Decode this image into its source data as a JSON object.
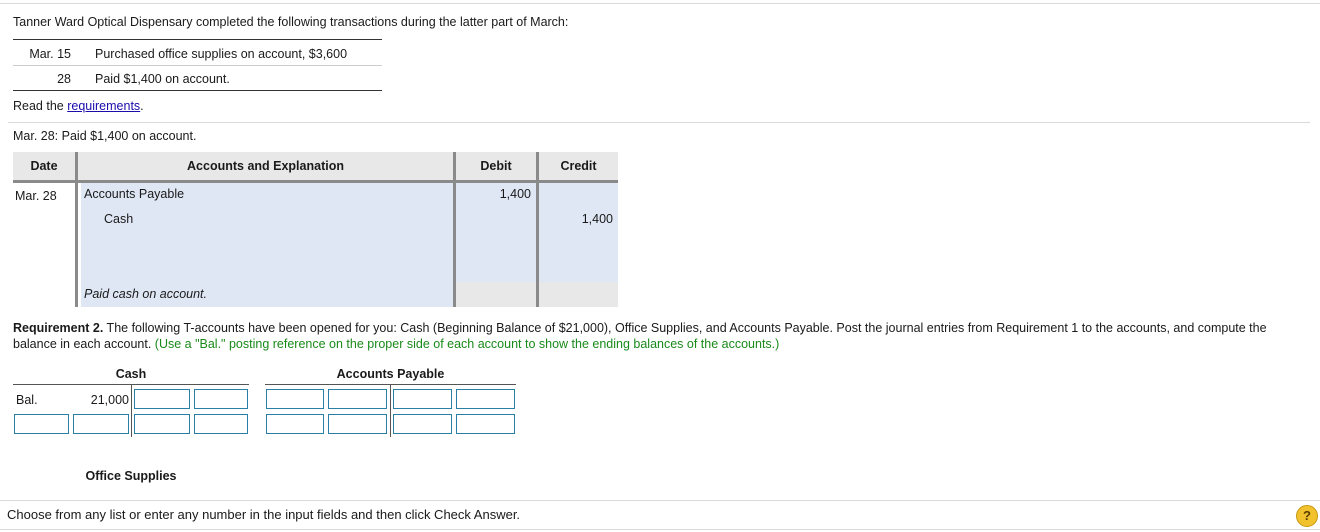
{
  "intro": "Tanner Ward Optical Dispensary completed the following transactions during the latter part of March:",
  "transactions": [
    {
      "date": "Mar. 15",
      "desc": "Purchased office supplies on account, $3,600"
    },
    {
      "date": "28",
      "desc": "Paid $1,400 on account."
    }
  ],
  "read_prefix": "Read the ",
  "read_link": "requirements",
  "read_suffix": ".",
  "task_line": "Mar. 28: Paid $1,400 on account.",
  "journal": {
    "headers": {
      "date": "Date",
      "accounts": "Accounts and Explanation",
      "debit": "Debit",
      "credit": "Credit"
    },
    "date": "Mar. 28",
    "debit_account": "Accounts Payable",
    "credit_account": "Cash",
    "debit_amount": "1,400",
    "credit_amount": "1,400",
    "explanation": "Paid cash on account."
  },
  "requirement": {
    "label": "Requirement 2.",
    "text": " The following T-accounts have been opened for you: Cash (Beginning Balance of $21,000), Office Supplies, and Accounts Payable. Post the journal entries from Requirement 1 to the accounts, and compute the balance in each account. ",
    "hint": "(Use a \"Bal.\" posting reference on the proper side of each account to show the ending balances of the accounts.)"
  },
  "taccounts": {
    "cash_title": "Cash",
    "ap_title": "Accounts Payable",
    "office_title": "Office Supplies",
    "bal_label": "Bal.",
    "bal_value": "21,000"
  },
  "footer": "Choose from any list or enter any number in the input fields and then click Check Answer.",
  "help_label": "?"
}
